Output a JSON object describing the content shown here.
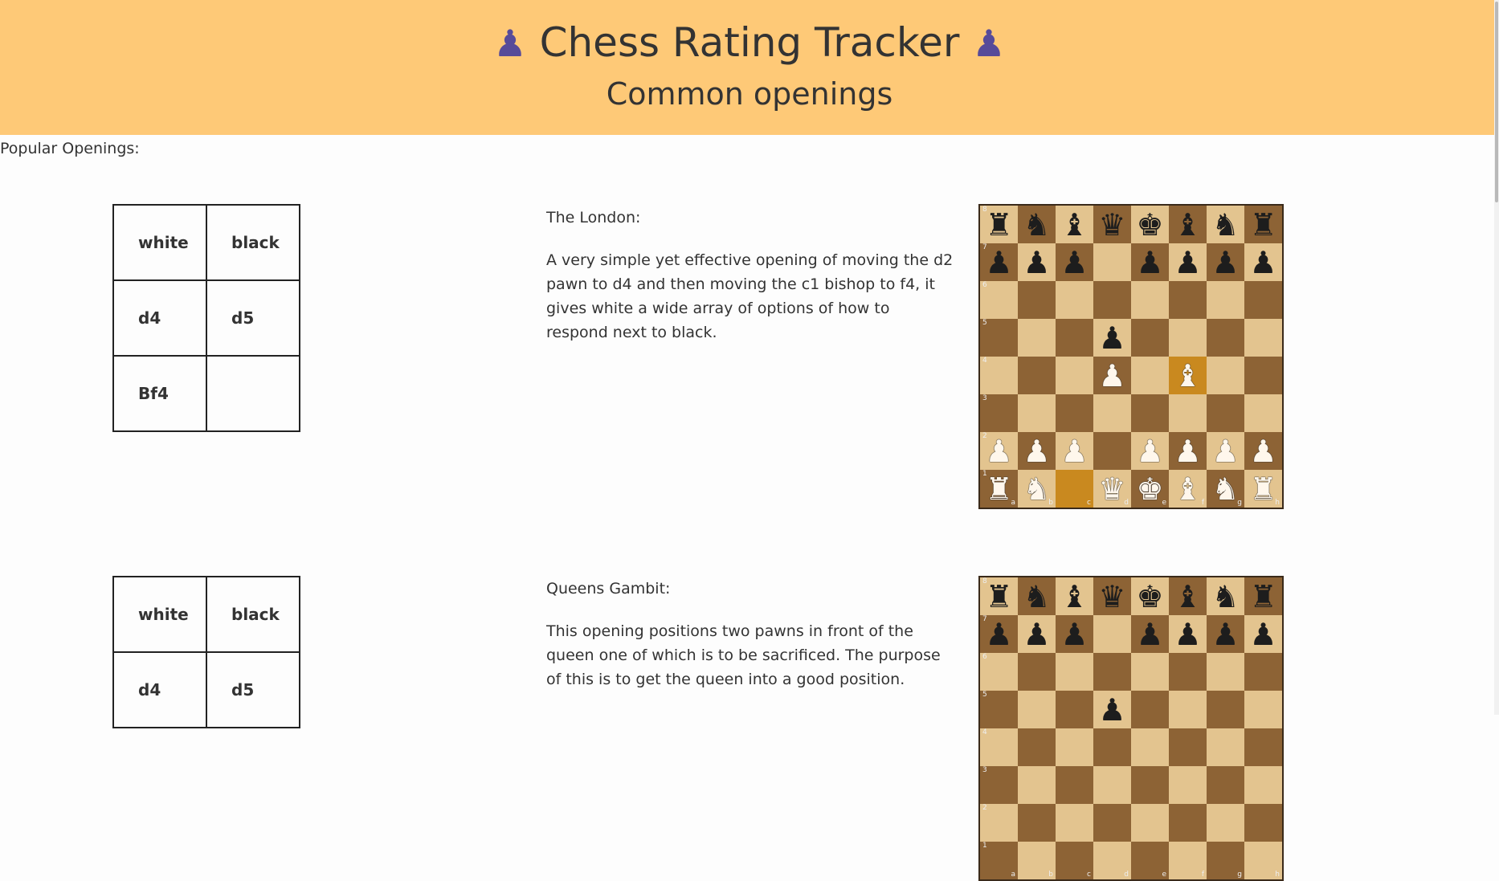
{
  "header": {
    "title": "Chess Rating Tracker",
    "pawn_icon": "♟",
    "subtitle": "Common openings",
    "bg_color": "#fec977",
    "icon_color": "#574b99"
  },
  "popular_label": "Popular Openings:",
  "openings": [
    {
      "name": "The London:",
      "description": "A very simple yet effective opening of moving the d2 pawn to d4 and then moving the c1 bishop to f4, it gives white a wide array of options of how to respond next to black.",
      "table": {
        "header": [
          "white",
          "black"
        ],
        "rows": [
          [
            "d4",
            "d5"
          ],
          [
            "Bf4",
            ""
          ]
        ]
      },
      "board": [
        "rnbqkbnr",
        "ppp.pppp",
        "........",
        "...p....",
        "...P.B..",
        "........",
        "PPP.PPPP",
        "RN.QKBNR"
      ],
      "highlight": [
        "c1",
        "f4"
      ]
    },
    {
      "name": "Queens Gambit:",
      "description": "This opening positions two pawns in front of the queen one of which is to be sacrificed. The purpose of this is to get the queen into a good position.",
      "table": {
        "header": [
          "white",
          "black"
        ],
        "rows": [
          [
            "d4",
            "d5"
          ]
        ]
      },
      "board": [
        "rnbqkbnr",
        "ppp.pppp",
        "........",
        "...p....",
        "........",
        "........",
        "........",
        "........"
      ],
      "highlight": []
    }
  ]
}
